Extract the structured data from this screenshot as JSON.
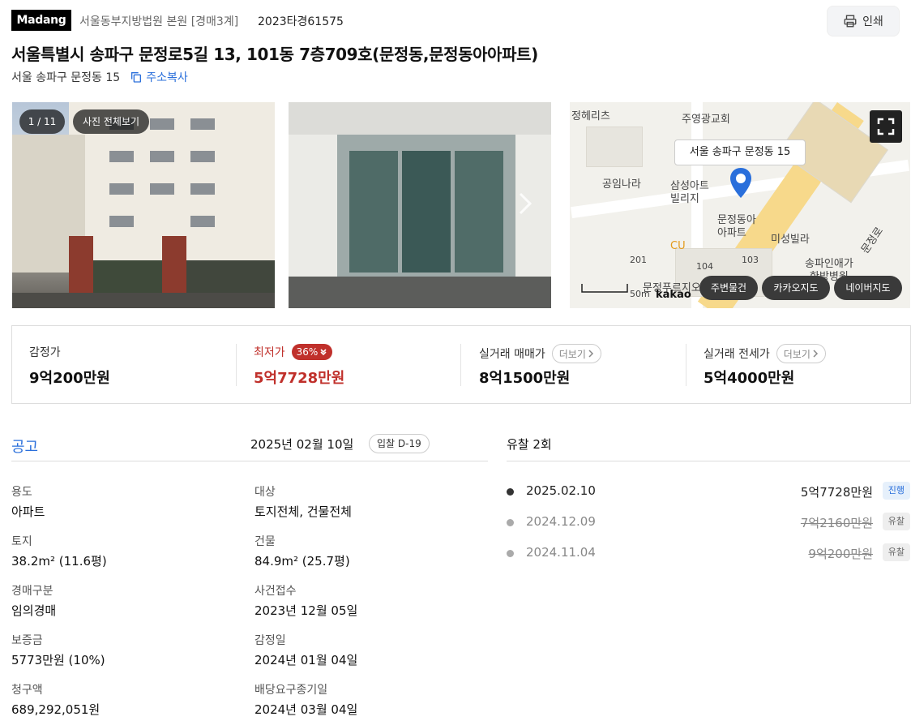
{
  "header": {
    "logo": "Madang",
    "court": "서울동부지방법원 본원 [경매3계]",
    "case_no": "2023타경61575",
    "print_label": "인쇄"
  },
  "property": {
    "title": "서울특별시 송파구 문정로5길 13, 101동 7층709호(문정동,문정동아아파트)",
    "lot_address": "서울 송파구 문정동 15",
    "copy_label": "주소복사"
  },
  "gallery": {
    "counter": "1 / 11",
    "view_all": "사진 전체보기"
  },
  "map": {
    "tooltip": "서울 송파구 문정동 15",
    "labels": [
      "주영광교회",
      "공임나라",
      "삼성아트",
      "빌리지",
      "문정동아",
      "아파트",
      "미성빌라",
      "송파인애가",
      "한방병원",
      "CU",
      "201",
      "104",
      "103",
      "문정푸르지오",
      "문정로",
      "정헤리츠"
    ],
    "scale": "50m",
    "brand": "kakao",
    "buttons": [
      "주변물건",
      "카카오지도",
      "네이버지도"
    ]
  },
  "prices": {
    "appraisal_label": "감정가",
    "appraisal_value": "9억200만원",
    "minimum_label": "최저가",
    "minimum_pct": "36%",
    "minimum_value": "5억7728만원",
    "sale_label": "실거래 매매가",
    "sale_value": "8억1500만원",
    "rent_label": "실거래 전세가",
    "rent_value": "5억4000만원",
    "more_label": "더보기"
  },
  "notice": {
    "title": "공고",
    "date": "2025년 02월 10일",
    "dday": "입찰 D-19",
    "fields": [
      {
        "k": "용도",
        "v": "아파트"
      },
      {
        "k": "대상",
        "v": "토지전체, 건물전체"
      },
      {
        "k": "토지",
        "v": "38.2m² (11.6평)"
      },
      {
        "k": "건물",
        "v": "84.9m² (25.7평)"
      },
      {
        "k": "경매구분",
        "v": "임의경매"
      },
      {
        "k": "사건접수",
        "v": "2023년 12월 05일"
      },
      {
        "k": "보증금",
        "v": "5773만원 (10%)"
      },
      {
        "k": "감정일",
        "v": "2024년 01월 04일"
      },
      {
        "k": "청구액",
        "v": "689,292,051원"
      },
      {
        "k": "배당요구종기일",
        "v": "2024년 03월 04일"
      }
    ]
  },
  "history": {
    "title": "유찰 2회",
    "rows": [
      {
        "date": "2025.02.10",
        "amount": "5억7728만원",
        "status": "진행"
      },
      {
        "date": "2024.12.09",
        "amount": "7억2160만원",
        "status": "유찰"
      },
      {
        "date": "2024.11.04",
        "amount": "9억200만원",
        "status": "유찰"
      }
    ]
  }
}
